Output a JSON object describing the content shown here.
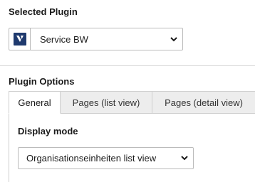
{
  "selected_plugin": {
    "title": "Selected Plugin",
    "value": "Service BW",
    "icon": "plugin-logo-icon"
  },
  "plugin_options": {
    "title": "Plugin Options",
    "tabs": [
      {
        "label": "General",
        "active": true
      },
      {
        "label": "Pages (list view)",
        "active": false
      },
      {
        "label": "Pages (detail view)",
        "active": false
      }
    ],
    "display_mode": {
      "label": "Display mode",
      "value": "Organisationseinheiten list view"
    }
  },
  "colors": {
    "icon_bg": "#1f3a6e",
    "border": "#bbbbbb",
    "tab_inactive_bg": "#ededed"
  }
}
